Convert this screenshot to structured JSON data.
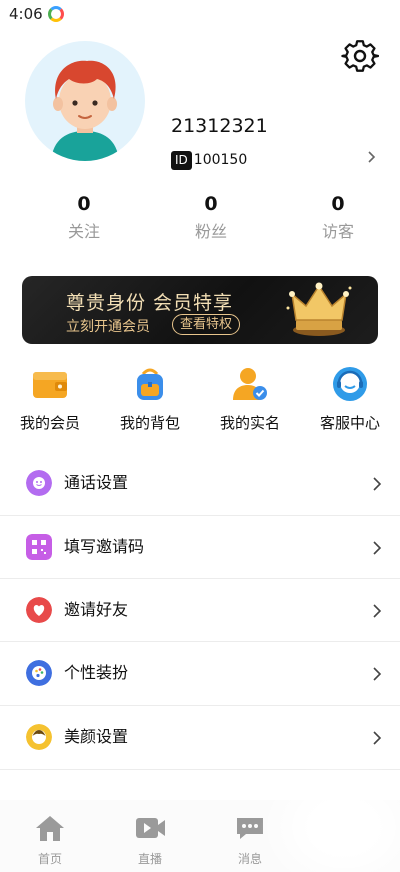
{
  "status_bar": {
    "time": "4:06"
  },
  "profile": {
    "username": "21312321",
    "id_badge": "ID",
    "id_value": "100150"
  },
  "stats": [
    {
      "value": "0",
      "label": "关注"
    },
    {
      "value": "0",
      "label": "粉丝"
    },
    {
      "value": "0",
      "label": "访客"
    }
  ],
  "vip_banner": {
    "title": "尊贵身份 会员特享",
    "subtitle": "立刻开通会员",
    "button": "查看特权",
    "accent": "#e8c58d"
  },
  "quick_actions": [
    {
      "label": "我的会员",
      "icon": "wallet-icon"
    },
    {
      "label": "我的背包",
      "icon": "backpack-icon"
    },
    {
      "label": "我的实名",
      "icon": "verified-user-icon"
    },
    {
      "label": "客服中心",
      "icon": "customer-service-icon"
    }
  ],
  "menu": [
    {
      "label": "通话设置",
      "icon": "call-settings-icon",
      "color": "#b36cf0"
    },
    {
      "label": "填写邀请码",
      "icon": "qr-code-icon",
      "color": "#c65ee6"
    },
    {
      "label": "邀请好友",
      "icon": "heart-icon",
      "color": "#e84a4a"
    },
    {
      "label": "个性装扮",
      "icon": "palette-icon",
      "color": "#3f6fe0"
    },
    {
      "label": "美颜设置",
      "icon": "beauty-icon",
      "color": "#f5c230"
    }
  ],
  "tab_bar": [
    {
      "label": "首页",
      "icon": "home-icon"
    },
    {
      "label": "直播",
      "icon": "video-camera-icon"
    },
    {
      "label": "消息",
      "icon": "message-icon"
    }
  ]
}
